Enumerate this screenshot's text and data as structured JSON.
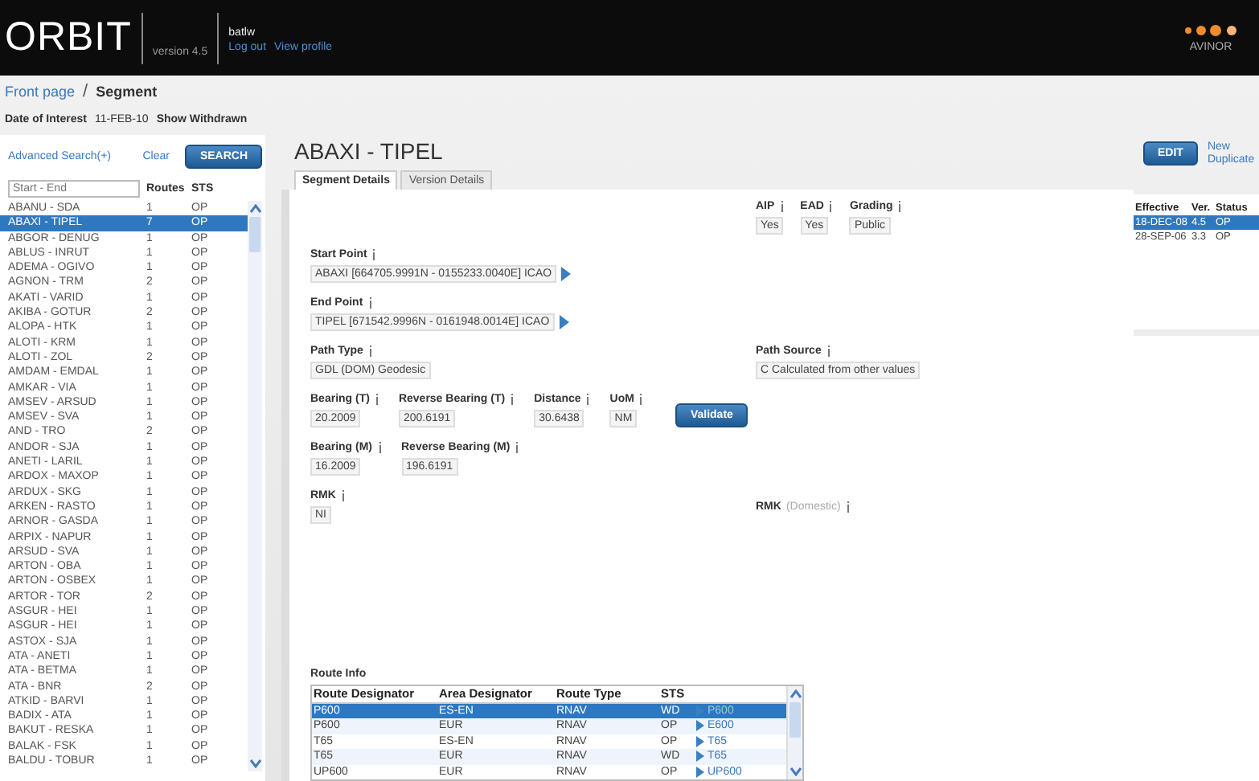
{
  "header": {
    "logo": "ORBIT",
    "version": "version 4.5",
    "user": "batlw",
    "links": [
      "Log out",
      "View profile"
    ],
    "brand": "AVINOR"
  },
  "breadcrumb": {
    "items": [
      "Front page",
      "Segment"
    ],
    "separator": "/"
  },
  "filter": {
    "date_label": "Date of Interest",
    "date_value": "11-FEB-10",
    "show_withdrawn": "Show Withdrawn"
  },
  "search": {
    "advanced": "Advanced Search(+)",
    "clear": "Clear",
    "button": "SEARCH",
    "placeholder": "Start - End",
    "columns": [
      "Routes",
      "STS"
    ],
    "rows": [
      {
        "name": "ABANU - SDA",
        "routes": "1",
        "sts": "OP",
        "selected": false
      },
      {
        "name": "ABAXI - TIPEL",
        "routes": "7",
        "sts": "OP",
        "selected": true
      },
      {
        "name": "ABGOR - DENUG",
        "routes": "1",
        "sts": "OP",
        "selected": false
      },
      {
        "name": "ABLUS - INRUT",
        "routes": "1",
        "sts": "OP",
        "selected": false
      },
      {
        "name": "ADEMA - OGIVO",
        "routes": "1",
        "sts": "OP",
        "selected": false
      },
      {
        "name": "AGNON - TRM",
        "routes": "2",
        "sts": "OP",
        "selected": false
      },
      {
        "name": "AKATI - VARID",
        "routes": "1",
        "sts": "OP",
        "selected": false
      },
      {
        "name": "AKIBA - GOTUR",
        "routes": "2",
        "sts": "OP",
        "selected": false
      },
      {
        "name": "ALOPA - HTK",
        "routes": "1",
        "sts": "OP",
        "selected": false
      },
      {
        "name": "ALOTI - KRM",
        "routes": "1",
        "sts": "OP",
        "selected": false
      },
      {
        "name": "ALOTI - ZOL",
        "routes": "2",
        "sts": "OP",
        "selected": false
      },
      {
        "name": "AMDAM - EMDAL",
        "routes": "1",
        "sts": "OP",
        "selected": false
      },
      {
        "name": "AMKAR - VIA",
        "routes": "1",
        "sts": "OP",
        "selected": false
      },
      {
        "name": "AMSEV - ARSUD",
        "routes": "1",
        "sts": "OP",
        "selected": false
      },
      {
        "name": "AMSEV - SVA",
        "routes": "1",
        "sts": "OP",
        "selected": false
      },
      {
        "name": "AND - TRO",
        "routes": "2",
        "sts": "OP",
        "selected": false
      },
      {
        "name": "ANDOR - SJA",
        "routes": "1",
        "sts": "OP",
        "selected": false
      },
      {
        "name": "ANETI - LARIL",
        "routes": "1",
        "sts": "OP",
        "selected": false
      },
      {
        "name": "ARDOX - MAXOP",
        "routes": "1",
        "sts": "OP",
        "selected": false
      },
      {
        "name": "ARDUX - SKG",
        "routes": "1",
        "sts": "OP",
        "selected": false
      },
      {
        "name": "ARKEN - RASTO",
        "routes": "1",
        "sts": "OP",
        "selected": false
      },
      {
        "name": "ARNOR - GASDA",
        "routes": "1",
        "sts": "OP",
        "selected": false
      },
      {
        "name": "ARPIX - NAPUR",
        "routes": "1",
        "sts": "OP",
        "selected": false
      },
      {
        "name": "ARSUD - SVA",
        "routes": "1",
        "sts": "OP",
        "selected": false
      },
      {
        "name": "ARTON - OBA",
        "routes": "1",
        "sts": "OP",
        "selected": false
      },
      {
        "name": "ARTON - OSBEX",
        "routes": "1",
        "sts": "OP",
        "selected": false
      },
      {
        "name": "ARTOR - TOR",
        "routes": "2",
        "sts": "OP",
        "selected": false
      },
      {
        "name": "ASGUR - HEI",
        "routes": "1",
        "sts": "OP",
        "selected": false
      },
      {
        "name": "ASGUR - HEI",
        "routes": "1",
        "sts": "OP",
        "selected": false
      },
      {
        "name": "ASTOX - SJA",
        "routes": "1",
        "sts": "OP",
        "selected": false
      },
      {
        "name": "ATA - ANETI",
        "routes": "1",
        "sts": "OP",
        "selected": false
      },
      {
        "name": "ATA - BETMA",
        "routes": "1",
        "sts": "OP",
        "selected": false
      },
      {
        "name": "ATA - BNR",
        "routes": "2",
        "sts": "OP",
        "selected": false
      },
      {
        "name": "ATKID - BARVI",
        "routes": "1",
        "sts": "OP",
        "selected": false
      },
      {
        "name": "BADIX - ATA",
        "routes": "1",
        "sts": "OP",
        "selected": false
      },
      {
        "name": "BAKUT - RESKA",
        "routes": "1",
        "sts": "OP",
        "selected": false
      },
      {
        "name": "BALAK - FSK",
        "routes": "1",
        "sts": "OP",
        "selected": false
      },
      {
        "name": "BALDU - TOBUR",
        "routes": "1",
        "sts": "OP",
        "selected": false
      }
    ]
  },
  "segment": {
    "title": "ABAXI - TIPEL",
    "tabs": [
      {
        "label": "Segment Details",
        "selected": true
      },
      {
        "label": "Version Details",
        "selected": false
      }
    ],
    "flags": [
      {
        "label": "AIP",
        "value": "Yes"
      },
      {
        "label": "EAD",
        "value": "Yes"
      },
      {
        "label": "Grading",
        "value": "Public"
      }
    ],
    "start_point": {
      "label": "Start Point",
      "value": "ABAXI [664705.9991N - 0155233.0040E] ICAO"
    },
    "end_point": {
      "label": "End Point",
      "value": "TIPEL [671542.9996N - 0161948.0014E] ICAO"
    },
    "path_type": {
      "label": "Path Type",
      "value": "GDL (DOM) Geodesic"
    },
    "path_source": {
      "label": "Path Source",
      "value": "C Calculated from other values"
    },
    "bearings_true": [
      {
        "label": "Bearing (T)",
        "value": "20.2009"
      },
      {
        "label": "Reverse Bearing (T)",
        "value": "200.6191"
      },
      {
        "label": "Distance",
        "value": "30.6438"
      },
      {
        "label": "UoM",
        "value": "NM"
      }
    ],
    "validate": "Validate",
    "bearings_magnetic": [
      {
        "label": "Bearing (M)",
        "value": "16.2009"
      },
      {
        "label": "Reverse Bearing (M)",
        "value": "196.6191"
      }
    ],
    "rmk": {
      "label": "RMK",
      "value": "NI"
    },
    "rmk_domestic": {
      "label": "RMK",
      "note": "(Domestic)"
    }
  },
  "actions": {
    "edit": "EDIT",
    "links": [
      "New",
      "Duplicate"
    ]
  },
  "versions": {
    "columns": [
      "Effective",
      "Ver.",
      "Status"
    ],
    "rows": [
      {
        "effective": "18-DEC-08",
        "ver": "4.5",
        "status": "OP",
        "selected": true
      },
      {
        "effective": "28-SEP-06",
        "ver": "3.3",
        "status": "OP",
        "selected": false
      }
    ]
  },
  "route_info": {
    "title": "Route Info",
    "columns": [
      "Route Designator",
      "Area Designator",
      "Route Type",
      "STS"
    ],
    "rows": [
      {
        "designator": "P600",
        "area": "ES-EN",
        "type": "RNAV",
        "sts": "WD",
        "link": "P600",
        "selected": true
      },
      {
        "designator": "P600",
        "area": "EUR",
        "type": "RNAV",
        "sts": "OP",
        "link": "E600",
        "selected": false
      },
      {
        "designator": "T65",
        "area": "ES-EN",
        "type": "RNAV",
        "sts": "OP",
        "link": "T65",
        "selected": false
      },
      {
        "designator": "T65",
        "area": "EUR",
        "type": "RNAV",
        "sts": "WD",
        "link": "T65",
        "selected": false
      },
      {
        "designator": "UP600",
        "area": "EUR",
        "type": "RNAV",
        "sts": "OP",
        "link": "UP600",
        "selected": false
      }
    ]
  }
}
